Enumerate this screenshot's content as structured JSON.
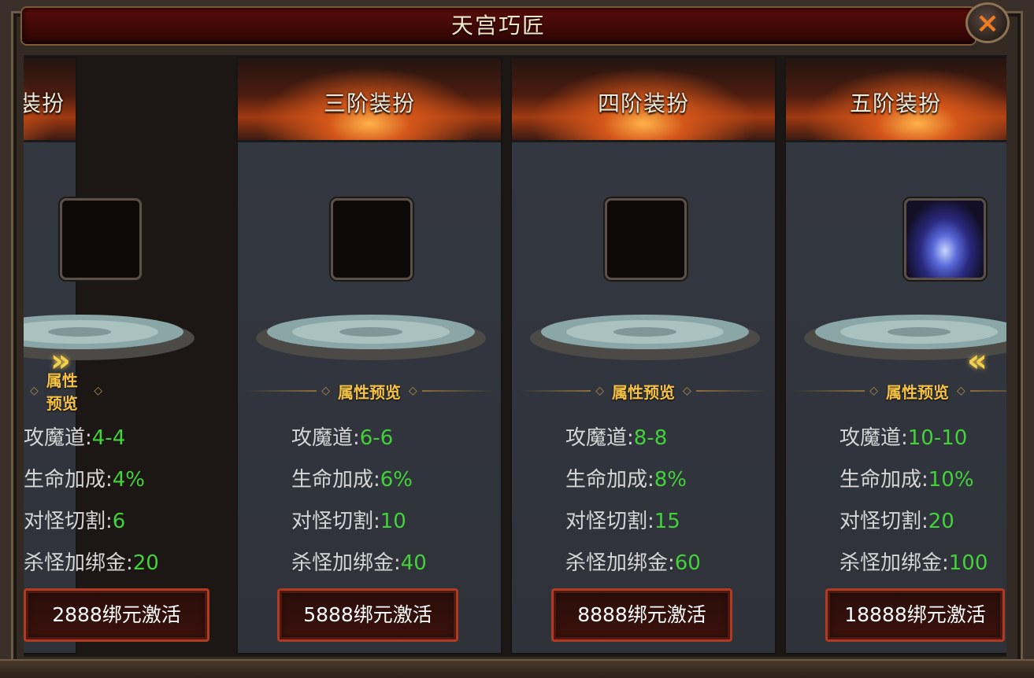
{
  "title": "天宫巧匠",
  "close_icon": "×",
  "preview_label": "属性预览",
  "stat_labels": [
    "攻魔道:",
    "生命加成:",
    "对怪切割:",
    "杀怪加绑金:"
  ],
  "cards": [
    {
      "title": "二阶装扮",
      "stats": [
        "4-4",
        "4%",
        "6",
        "20"
      ],
      "button": "2888绑元激活"
    },
    {
      "title": "三阶装扮",
      "stats": [
        "6-6",
        "6%",
        "10",
        "40"
      ],
      "button": "5888绑元激活"
    },
    {
      "title": "四阶装扮",
      "stats": [
        "8-8",
        "8%",
        "15",
        "60"
      ],
      "button": "8888绑元激活"
    },
    {
      "title": "五阶装扮",
      "stats": [
        "10-10",
        "10%",
        "20",
        "100"
      ],
      "button": "18888绑元激活"
    }
  ],
  "arrows": {
    "right": "»",
    "left": "«"
  },
  "colors": {
    "stat_value": "#42d23a",
    "preview_gold": "#f5c243",
    "close_orange": "#f07a22",
    "button_border": "#b23a22"
  }
}
